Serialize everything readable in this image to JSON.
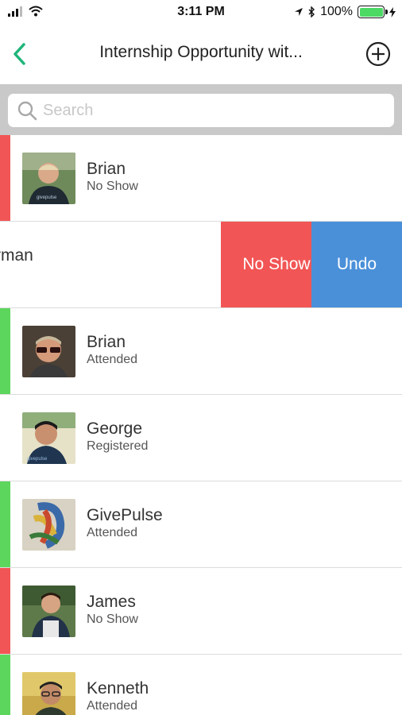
{
  "status_bar": {
    "time": "3:11 PM",
    "battery": "100%"
  },
  "nav": {
    "title": "Internship Opportunity wit..."
  },
  "search": {
    "placeholder": "Search"
  },
  "colors": {
    "accent": "#1fb57a",
    "no_show": "#f25555",
    "attended": "#5cd65c",
    "undo": "#4a90d9"
  },
  "attendees": [
    {
      "name": "Brian",
      "status": "No Show",
      "indicator": "red",
      "avatar": "photo-avatar-1"
    },
    {
      "name": "rman",
      "swiped": true,
      "actions": [
        "No Show",
        "Undo"
      ]
    },
    {
      "name": "Brian",
      "status": "Attended",
      "indicator": "green",
      "avatar": "photo-avatar-2"
    },
    {
      "name": "George",
      "status": "Registered",
      "indicator": "none",
      "avatar": "photo-avatar-3"
    },
    {
      "name": "GivePulse",
      "status": "Attended",
      "indicator": "green",
      "avatar": "photo-avatar-4"
    },
    {
      "name": "James",
      "status": "No Show",
      "indicator": "red",
      "avatar": "photo-avatar-5"
    },
    {
      "name": "Kenneth",
      "status": "Attended",
      "indicator": "green",
      "avatar": "photo-avatar-6"
    }
  ]
}
